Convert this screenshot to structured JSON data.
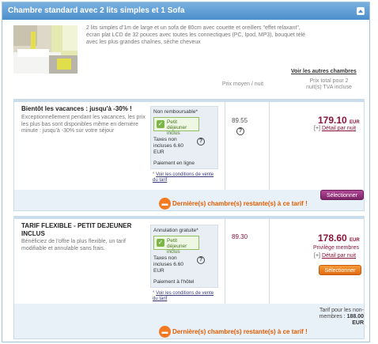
{
  "header": {
    "title": "Chambre standard avec 2 lits simples et 1 Sofa"
  },
  "room": {
    "description": "2 lits simples d'1m de large et un sofa de 80cm avec couette et oreillers \"effet relaxant\", écran plat LCD de 32 pouces avec toutes les connectiques (PC, Ipod, MP3), bouquet télé avec les plus grandes chaînes, sèche cheveux",
    "see_other": "Voir les autres chambres"
  },
  "columns": {
    "price_night": "Prix moyen / nuit",
    "price_total": "Prix total pour 2 nuit(s) TVA incluse"
  },
  "offers": [
    {
      "title": "Bientôt les vacances : jusqu'à -30% !",
      "text": "Exceptionnellement pendant les vacances, les prix les plus bas sont disponibles même en dernière minute : jusqu'à -30% sur votre séjour",
      "condition": "Non remboursable*",
      "breakfast": "Petit déjeuner inclus",
      "taxes": "Taxes non incluses 6.60 EUR",
      "payment": "Paiement en ligne",
      "cgv": "Voir les conditions de vente du tarif",
      "price_night": "89.55",
      "total": "179.10",
      "currency": "EUR",
      "detail_prefix": "[+]",
      "detail": "Détail par nuit",
      "button": "Sélectionner",
      "warning": "Dernière(s) chambre(s) restante(s) à ce tarif !"
    },
    {
      "title": "TARIF FLEXIBLE - PETIT DEJEUNER INCLUS",
      "text": "Bénéficiez de l'offre la plus flexible, un tarif modifiable et annulable sans frais.",
      "condition": "Annulation gratuite*",
      "breakfast": "Petit déjeuner inclus",
      "taxes": "Taxes non incluses 6.60 EUR",
      "payment": "Paiement à l'hôtel",
      "cgv": "Voir les conditions de vente du tarif",
      "price_night": "89.30",
      "total": "178.60",
      "currency": "EUR",
      "member": "Privilège membres",
      "detail_prefix": "[+]",
      "detail": "Détail par nuit",
      "button": "Sélectionner",
      "nonmember_label": "Tarif pour les non-membres :",
      "nonmember_price": "188.00 EUR",
      "warning": "Dernière(s) chambre(s) restante(s) à ce tarif !"
    }
  ],
  "colors": {
    "header": "#4b8fcc",
    "price": "#8a1538",
    "warning": "#e25c00"
  }
}
